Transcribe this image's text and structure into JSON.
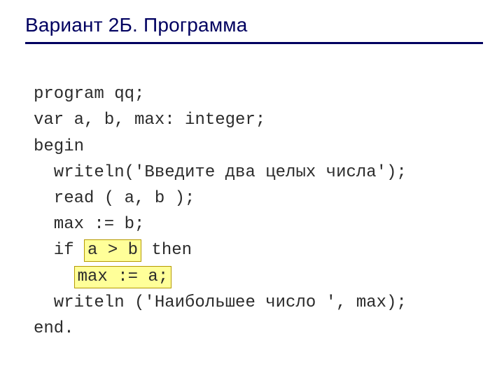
{
  "title": "Вариант 2Б. Программа",
  "code": {
    "l1": "program qq;",
    "l2": "var a, b, max: integer;",
    "l3": "begin",
    "l4": "writeln('Введите два целых числа');",
    "l5": "read ( a, b );",
    "l6": "max := b;",
    "l7_pre": "if ",
    "l7_hl": "a > b",
    "l7_post": " then",
    "l8_hl": "max := a;",
    "l9": "writeln ('Наибольшее число ', max);",
    "l10": "end."
  }
}
